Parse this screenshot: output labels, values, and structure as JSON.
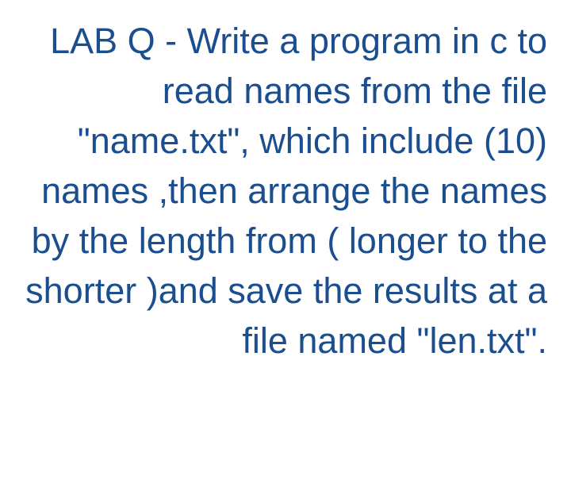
{
  "question": {
    "text": "LAB Q - Write a program in c to read names from the file \"name.txt\", which include (10) names ,then arrange the names by the length from ( longer to the shorter )and save the results at a file named \"len.txt\"."
  }
}
